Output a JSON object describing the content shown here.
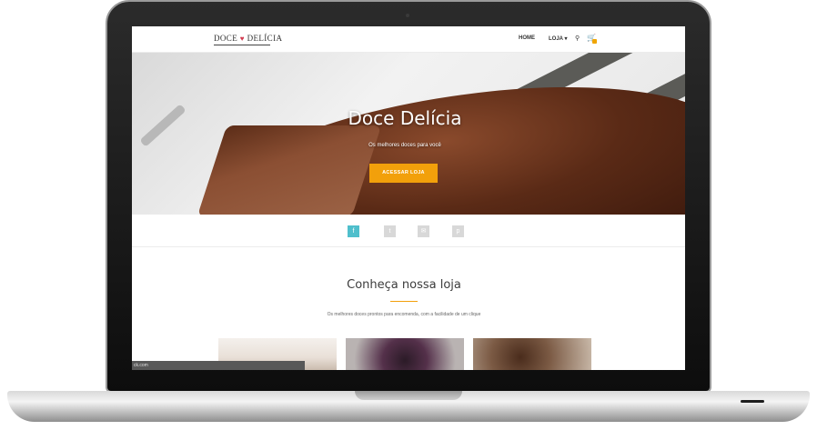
{
  "brand": {
    "name_part1": "DOCE",
    "name_part2": "DELÍCIA",
    "heart_icon": "heart-icon"
  },
  "nav": {
    "home": "HOME",
    "loja": "LOJA",
    "loja_caret": "▾",
    "search_icon": "search-icon",
    "cart_icon": "cart-icon"
  },
  "hero": {
    "title": "Doce Delícia",
    "subtitle": "Os melhores doces para você",
    "button": "ACESSAR LOJA"
  },
  "social": [
    {
      "icon": "facebook-icon",
      "glyph": "f",
      "color": "#4fbfcc"
    },
    {
      "icon": "twitter-icon",
      "glyph": "t",
      "color": "#d8d8d8"
    },
    {
      "icon": "email-icon",
      "glyph": "✉",
      "color": "#d8d8d8"
    },
    {
      "icon": "pinterest-icon",
      "glyph": "p",
      "color": "#d8d8d8"
    }
  ],
  "section": {
    "title": "Conheça nossa loja",
    "subtitle": "Os melhores doces prontos para encomenda, com a facilidade de um clique"
  },
  "status_url": "ck.com",
  "colors": {
    "accent": "#f2a00b",
    "social_active": "#4fbfcc"
  }
}
